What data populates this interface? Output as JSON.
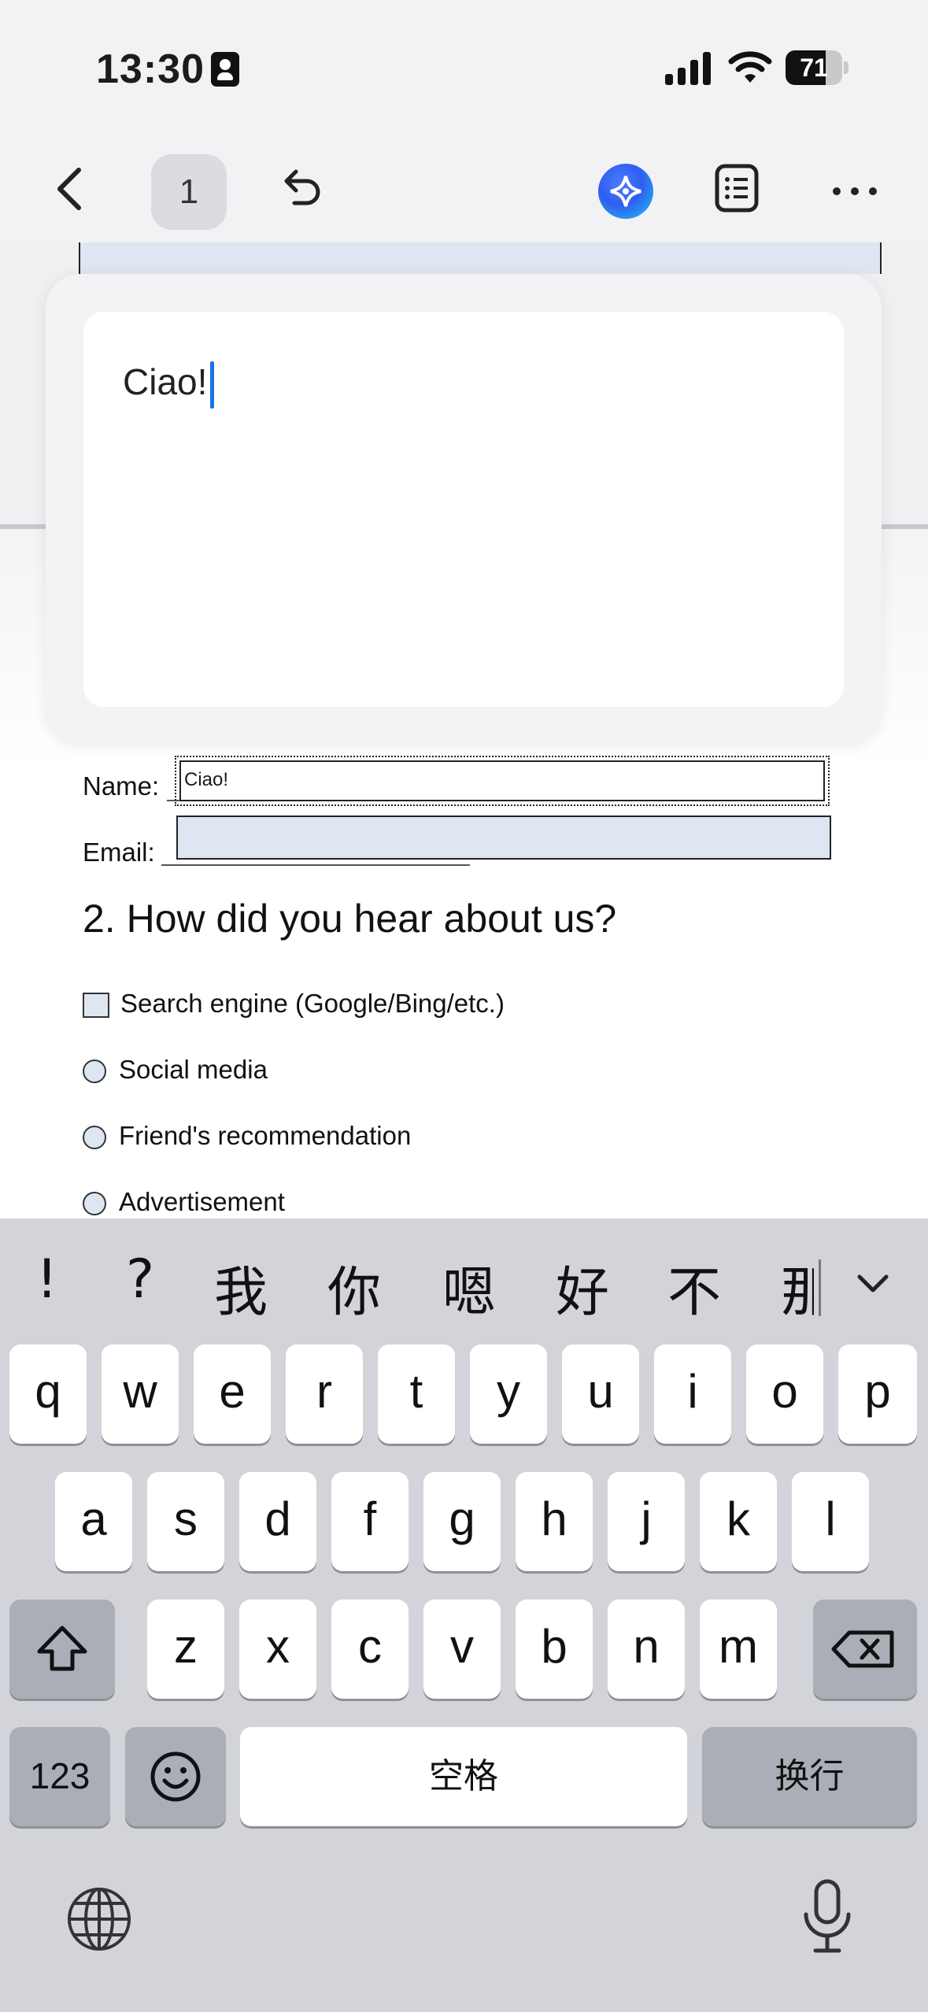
{
  "status_bar": {
    "time": "13:30",
    "battery": "71",
    "battery_level": 0.71
  },
  "toolbar": {
    "page_number": "1"
  },
  "popup": {
    "text": "Ciao!"
  },
  "form": {
    "name_label": "Name:",
    "name_value": "Ciao!",
    "email_label": "Email:",
    "question": "2. How did you hear about us?",
    "options": [
      {
        "label": "Search engine (Google/Bing/etc.)",
        "type": "checkbox"
      },
      {
        "label": "Social media",
        "type": "radio"
      },
      {
        "label": "Friend's recommendation",
        "type": "radio"
      },
      {
        "label": "Advertisement",
        "type": "radio"
      }
    ]
  },
  "keyboard": {
    "candidates": [
      "!",
      "?",
      "我",
      "你",
      "嗯",
      "好",
      "不",
      "那"
    ],
    "row1": [
      "q",
      "w",
      "e",
      "r",
      "t",
      "y",
      "u",
      "i",
      "o",
      "p"
    ],
    "row2": [
      "a",
      "s",
      "d",
      "f",
      "g",
      "h",
      "j",
      "k",
      "l"
    ],
    "row3": [
      "z",
      "x",
      "c",
      "v",
      "b",
      "n",
      "m"
    ],
    "numbers_key": "123",
    "space_key": "空格",
    "return_key": "换行"
  },
  "icons": [
    "back-icon",
    "undo-icon",
    "ai-assistant-icon",
    "list-icon",
    "more-icon",
    "shift-icon",
    "backspace-icon",
    "emoji-icon",
    "globe-icon",
    "microphone-icon",
    "chevron-down-icon"
  ]
}
